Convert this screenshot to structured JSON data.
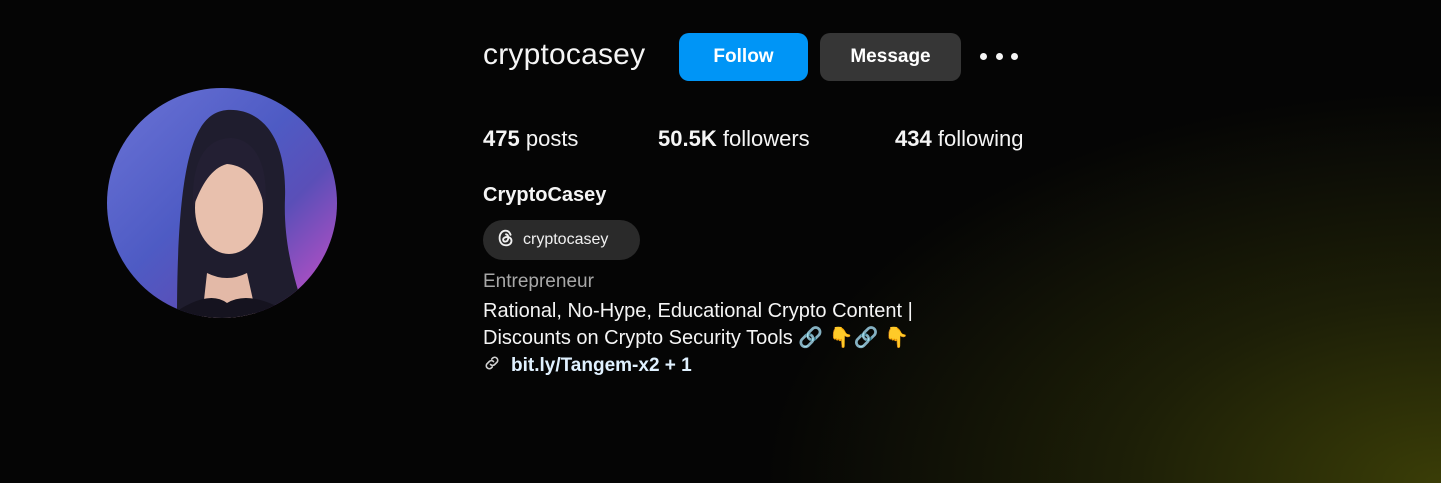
{
  "profile": {
    "username": "cryptocasey",
    "full_name": "CryptoCasey",
    "threads_handle": "cryptocasey",
    "category": "Entrepreneur",
    "bio_line1": "Rational, No-Hype, Educational Crypto Content |",
    "bio_line2": "Discounts on Crypto Security Tools 🔗 👇🔗 👇",
    "link_text": "bit.ly/Tangem-x2 + 1"
  },
  "actions": {
    "follow_label": "Follow",
    "message_label": "Message"
  },
  "stats": {
    "posts_count": "475",
    "posts_label": "posts",
    "followers_count": "50.5K",
    "followers_label": "followers",
    "following_count": "434",
    "following_label": "following"
  },
  "icons": {
    "more": "more-options-icon",
    "threads": "threads-icon",
    "link": "link-icon"
  },
  "colors": {
    "follow_button": "#0095f6",
    "message_button": "#363636",
    "background": "#000000"
  }
}
